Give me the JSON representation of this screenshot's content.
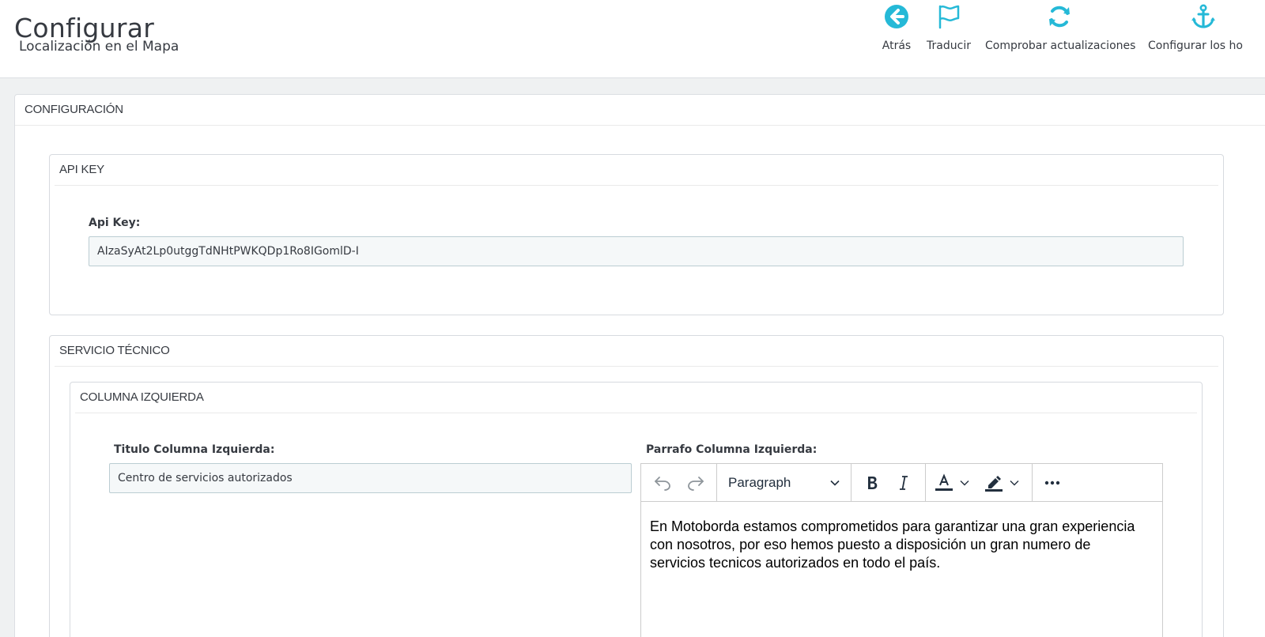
{
  "header": {
    "title": "Configurar",
    "subtitle": "Localización en el Mapa"
  },
  "toolbar": {
    "back_label": "Atrás",
    "translate_label": "Traducir",
    "updates_label": "Comprobar actualizaciones",
    "hooks_label": "Configurar los ho"
  },
  "colors": {
    "accent": "#25b9d7",
    "text": "#363a41"
  },
  "config": {
    "title": "CONFIGURACIÓN",
    "api_panel": {
      "title": "API KEY",
      "field_label": "Api Key:",
      "field_value": "AIzaSyAt2Lp0utggTdNHtPWKQDp1Ro8IGomlD-I"
    },
    "service_panel": {
      "title": "SERVICIO TÉCNICO",
      "left_column": {
        "title": "COLUMNA IZQUIERDA",
        "title_label": "Titulo Columna Izquierda:",
        "title_value": "Centro de servicios autorizados",
        "paragraph_label": "Parrafo Columna Izquierda:",
        "editor": {
          "block_format": "Paragraph",
          "content": "En Motoborda estamos comprometidos para garantizar una gran experiencia con nosotros, por eso hemos puesto a disposición un gran numero de servicios tecnicos autorizados en todo el país."
        }
      }
    }
  }
}
